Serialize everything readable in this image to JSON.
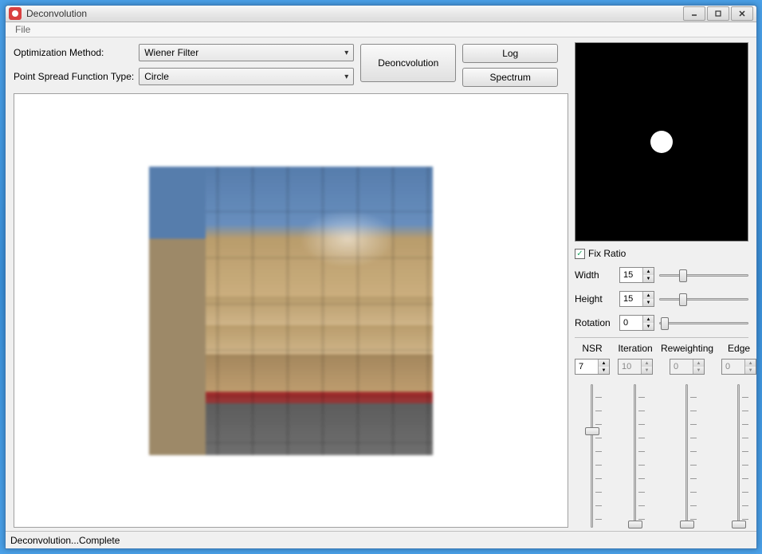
{
  "window": {
    "title": "Deconvolution"
  },
  "menu": {
    "file": "File"
  },
  "labels": {
    "opt_method": "Optimization Method:",
    "psf_type": "Point Spread Function Type:"
  },
  "selects": {
    "opt_method_value": "Wiener Filter",
    "psf_type_value": "Circle"
  },
  "buttons": {
    "deconv": "Deoncvolution",
    "log": "Log",
    "spectrum": "Spectrum"
  },
  "psf": {
    "fix_ratio_label": "Fix Ratio",
    "fix_ratio_checked": true,
    "width_label": "Width",
    "width_value": "15",
    "height_label": "Height",
    "height_value": "15",
    "rotation_label": "Rotation",
    "rotation_value": "0"
  },
  "params": {
    "nsr": {
      "label": "NSR",
      "value": "7",
      "enabled": true,
      "thumb_pct": 30
    },
    "iteration": {
      "label": "Iteration",
      "value": "10",
      "enabled": false,
      "thumb_pct": 95
    },
    "reweighting": {
      "label": "Reweighting",
      "value": "0",
      "enabled": false,
      "thumb_pct": 95
    },
    "edge": {
      "label": "Edge",
      "value": "0",
      "enabled": false,
      "thumb_pct": 95
    }
  },
  "status": "Deconvolution...Complete"
}
